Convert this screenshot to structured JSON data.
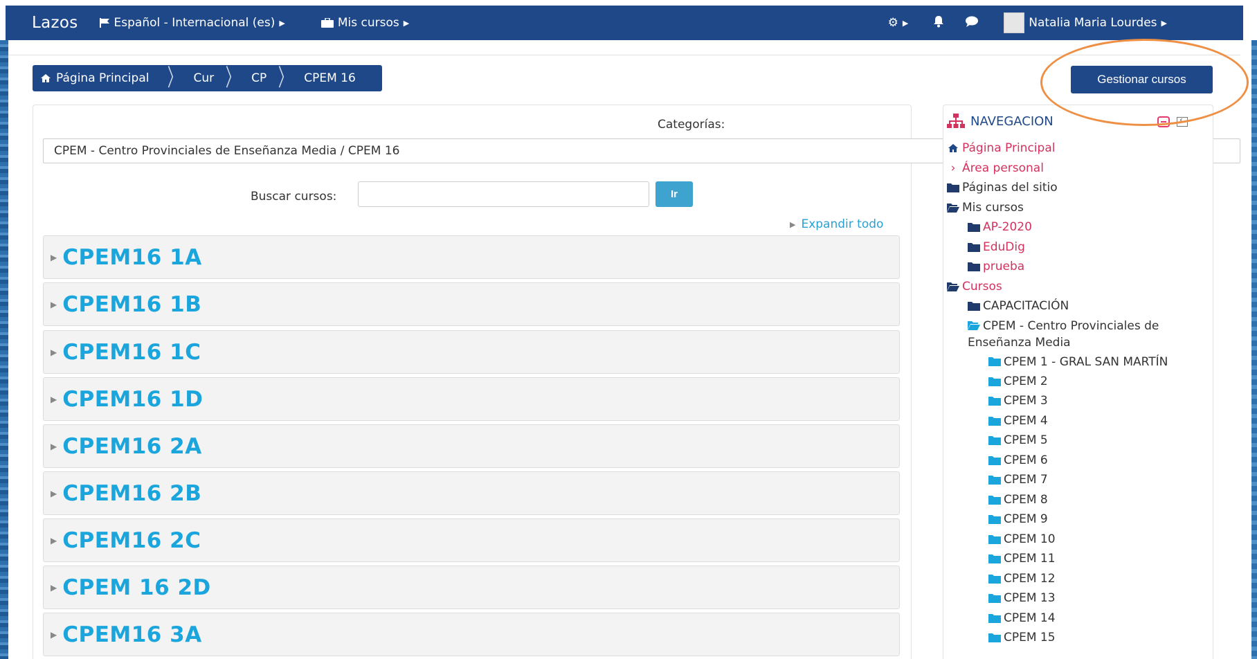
{
  "navbar": {
    "brand": "Lazos",
    "language": "Español - Internacional (es)",
    "my_courses": "Mis cursos",
    "user_name": "Natalia Maria Lourdes"
  },
  "breadcrumb": {
    "home": "Página Principal",
    "items": [
      "Cur",
      "CP",
      "CPEM 16"
    ]
  },
  "manage_button": "Gestionar cursos",
  "categories": {
    "label": "Categorías:",
    "selected": "CPEM - Centro Provinciales de Enseñanza Media / CPEM 16"
  },
  "search": {
    "label": "Buscar cursos:",
    "value": "",
    "go_label": "Ir"
  },
  "expand_all": "Expandir todo",
  "category_rows": [
    "CPEM16 1A",
    "CPEM16 1B",
    "CPEM16 1C",
    "CPEM16 1D",
    "CPEM16 2A",
    "CPEM16 2B",
    "CPEM16 2C",
    "CPEM 16 2D",
    "CPEM16 3A"
  ],
  "navigation": {
    "title": "NAVEGACION",
    "home": "Página Principal",
    "personal_area": "Área personal",
    "site_pages": "Páginas del sitio",
    "my_courses": "Mis cursos",
    "my_course_items": [
      "AP-2020",
      "EduDig",
      "prueba"
    ],
    "courses": "Cursos",
    "capacitacion": "CAPACITACIÓN",
    "cpem_root": "CPEM - Centro Provinciales de Enseñanza Media",
    "cpem_items": [
      "CPEM 1 - GRAL SAN MARTÍN",
      "CPEM 2",
      "CPEM 3",
      "CPEM 4",
      "CPEM 5",
      "CPEM 6",
      "CPEM 7",
      "CPEM 8",
      "CPEM 9",
      "CPEM 10",
      "CPEM 11",
      "CPEM 12",
      "CPEM 13",
      "CPEM 14",
      "CPEM 15"
    ]
  },
  "colors": {
    "navbar": "#1f4889",
    "link": "#1ba5dd",
    "nav_pink": "#d4325e",
    "annotation": "#ee8f44"
  }
}
